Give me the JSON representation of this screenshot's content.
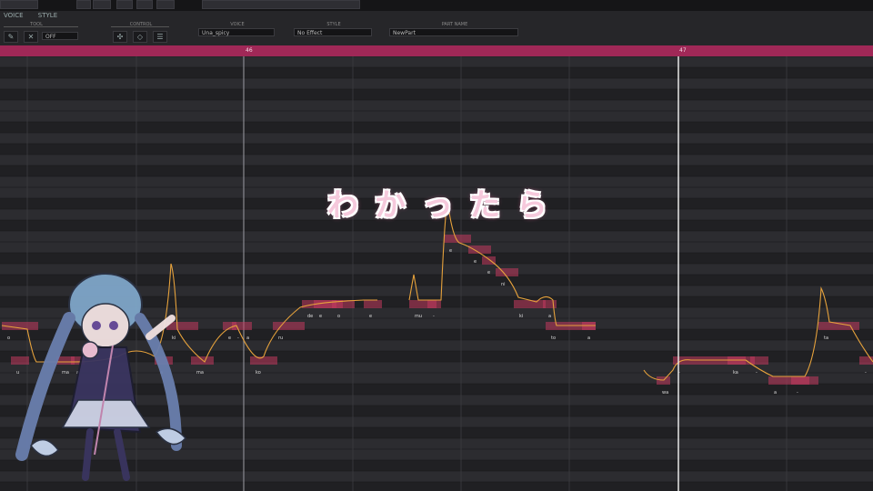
{
  "toolbar": {
    "tabs": [
      "VOICE",
      "STYLE"
    ],
    "tool_label": "TOOL",
    "tool_value": "OFF",
    "control_label": "CONTROL",
    "voice_label": "VOICE",
    "voice_value": "Una_spicy",
    "style_label": "STYLE",
    "style_value": "No Effect",
    "partname_label": "PART NAME",
    "partname_value": "NewPart"
  },
  "ruler": {
    "bars": [
      "46",
      "47"
    ]
  },
  "lyric_overlay": "わかったら",
  "colors": {
    "ruler": "#a02857",
    "note": "#c23a5e",
    "pitch_curve": "#e6a23c",
    "background": "#1c1c1e"
  },
  "notes": [
    {
      "lyric": "o"
    },
    {
      "lyric": "u"
    },
    {
      "lyric": "ma"
    },
    {
      "lyric": "a"
    },
    {
      "lyric": "ki"
    },
    {
      "lyric": "a"
    },
    {
      "lyric": "ma"
    },
    {
      "lyric": "e"
    },
    {
      "lyric": "-"
    },
    {
      "lyric": "a"
    },
    {
      "lyric": "ko"
    },
    {
      "lyric": "ru"
    },
    {
      "lyric": "de"
    },
    {
      "lyric": "e"
    },
    {
      "lyric": "o"
    },
    {
      "lyric": "e"
    },
    {
      "lyric": "mu"
    },
    {
      "lyric": "-"
    },
    {
      "lyric": "e"
    },
    {
      "lyric": "e"
    },
    {
      "lyric": "e"
    },
    {
      "lyric": "ni"
    },
    {
      "lyric": "ki"
    },
    {
      "lyric": "a"
    },
    {
      "lyric": "to"
    },
    {
      "lyric": "a"
    },
    {
      "lyric": "wa"
    },
    {
      "lyric": "-"
    },
    {
      "lyric": "ka"
    },
    {
      "lyric": "-"
    },
    {
      "lyric": "a"
    },
    {
      "lyric": "-"
    },
    {
      "lyric": "ta"
    },
    {
      "lyric": "-"
    }
  ]
}
